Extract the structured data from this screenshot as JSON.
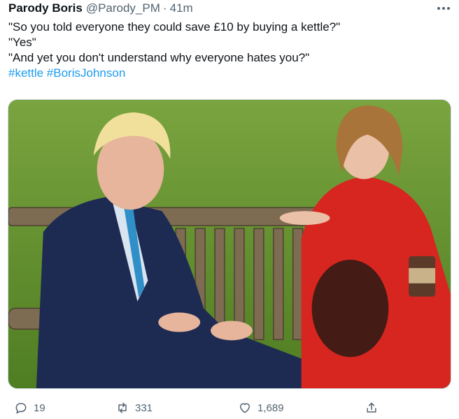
{
  "tweet": {
    "author_name": "Parody Boris",
    "handle": "@Parody_PM",
    "separator": "·",
    "time": "41m",
    "text_lines": [
      "\"So you told everyone they could save £10 by buying a kettle?\"",
      "\"Yes\"",
      "\"And yet you don't understand why everyone hates you?\""
    ],
    "hashtags": "#kettle #BorisJohnson",
    "counts": {
      "replies": "19",
      "retweets": "331",
      "likes": "1,689"
    }
  },
  "icons": {
    "more": "more-horizontal-icon",
    "reply": "reply-icon",
    "retweet": "retweet-icon",
    "like": "heart-icon",
    "share": "share-icon"
  },
  "colors": {
    "text": "#0f1419",
    "secondary": "#536471",
    "link": "#1d9bf0",
    "border": "#cfd9de"
  }
}
